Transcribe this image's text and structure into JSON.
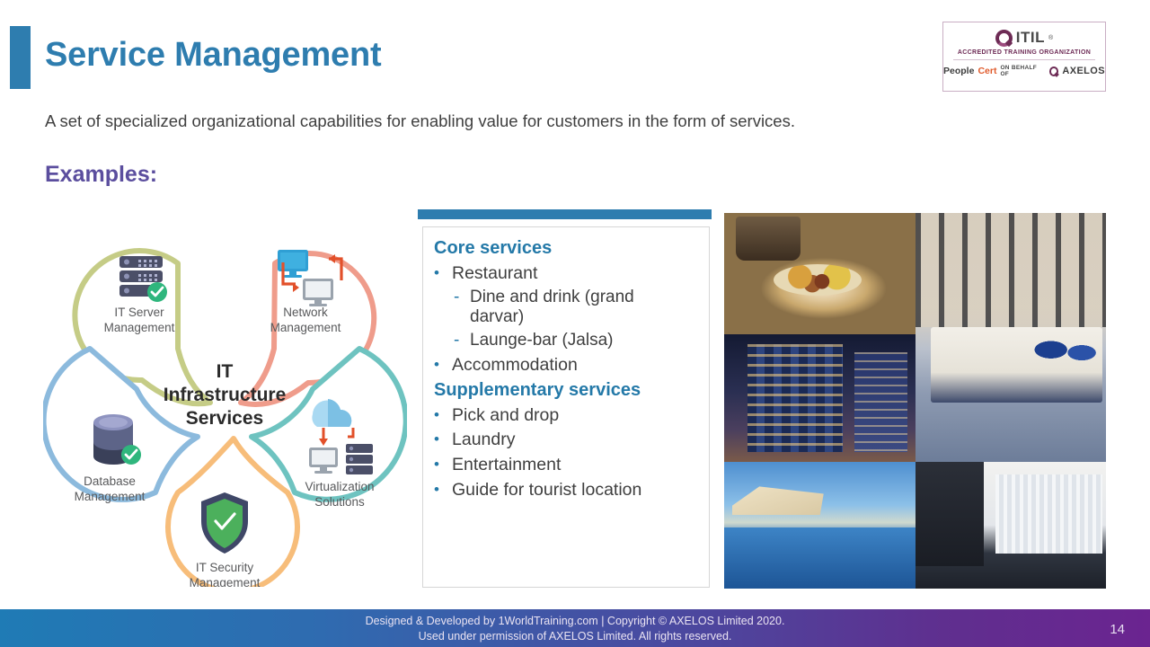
{
  "slide": {
    "title": "Service Management",
    "subtitle": "A set of specialized organizational capabilities for enabling value for customers in the form of services.",
    "examples_label": "Examples:",
    "page_number": "14",
    "accent_blue": "#2e7daf",
    "accent_purple": "#5b4e9e"
  },
  "badge": {
    "brand": "ITIL",
    "registered_mark": "®",
    "accreditation": "ACCREDITED TRAINING ORGANIZATION",
    "people": "People",
    "cert": "Cert",
    "on_behalf_of": "ON BEHALF OF",
    "axelos": "AXELOS"
  },
  "diagram": {
    "center_line1": "IT",
    "center_line2": "Infrastructure",
    "center_line3": "Services",
    "nodes": [
      {
        "id": "it-server-management",
        "label_line1": "IT Server",
        "label_line2": "Management",
        "icon": "server-stack-icon",
        "color": "#c5cc86"
      },
      {
        "id": "network-management",
        "label_line1": "Network",
        "label_line2": "Management",
        "icon": "two-monitors-arrows-icon",
        "color": "#ef9c8b"
      },
      {
        "id": "virtualization-solutions",
        "label_line1": "Virtualization",
        "label_line2": "Solutions",
        "icon": "cloud-server-monitor-icon",
        "color": "#6ec3c0"
      },
      {
        "id": "it-security-management",
        "label_line1": "IT Security",
        "label_line2": "Management",
        "icon": "shield-check-icon",
        "color": "#f7bd7a"
      },
      {
        "id": "database-management",
        "label_line1": "Database",
        "label_line2": "Management",
        "icon": "database-cylinder-icon",
        "color": "#8cbadd"
      }
    ]
  },
  "services": {
    "core_heading": "Core services",
    "core_items": [
      {
        "text": "Restaurant",
        "subitems": [
          "Dine and drink (grand darvar)",
          "Launge-bar (Jalsa)"
        ]
      },
      {
        "text": "Accommodation",
        "subitems": []
      }
    ],
    "supplementary_heading": "Supplementary services",
    "supplementary_items": [
      "Pick and drop",
      "Laundry",
      "Entertainment",
      "Guide for tourist location"
    ],
    "bullet_glyph": "•",
    "dash_glyph": "-"
  },
  "collage": {
    "photos": [
      {
        "name": "restaurant-food-plate-photo"
      },
      {
        "name": "hotel-bedroom-photo"
      },
      {
        "name": "hotel-building-night-photo"
      },
      {
        "name": "hotel-room-tv-photo"
      },
      {
        "name": "pool-terrace-photo"
      }
    ]
  },
  "footer": {
    "line1": "Designed & Developed by 1WorldTraining.com | Copyright © AXELOS Limited 2020.",
    "line2": "Used under permission of AXELOS Limited. All rights reserved."
  }
}
